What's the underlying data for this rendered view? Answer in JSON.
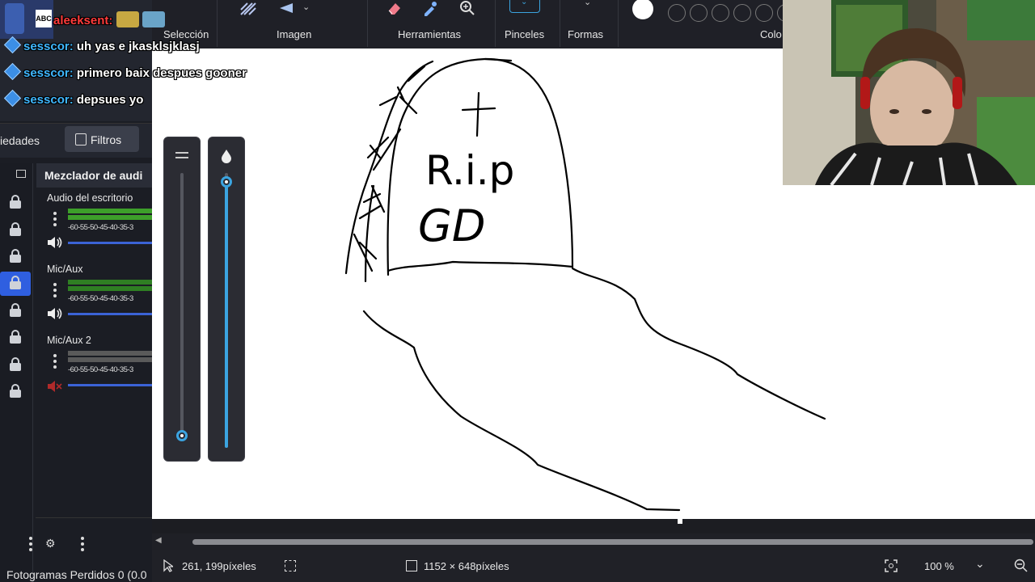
{
  "chat": {
    "messages": [
      {
        "user": "aleeksent:",
        "text": ""
      },
      {
        "user": "sesscor:",
        "text": "uh yas e jkasklsjklasj"
      },
      {
        "user": "sesscor:",
        "text": "primero baix despues gooner"
      },
      {
        "user": "sesscor:",
        "text": "depsues yo"
      }
    ]
  },
  "obs": {
    "tabs": {
      "properties": "iedades",
      "filters": "Filtros"
    },
    "mixer_title": "Mezclador de audi",
    "channels": [
      {
        "name": "Audio del escritorio",
        "scale": "-60-55-50-45-40-35-3",
        "muted": false
      },
      {
        "name": "Mic/Aux",
        "scale": "-60-55-50-45-40-35-3",
        "muted": false
      },
      {
        "name": "Mic/Aux 2",
        "scale": "-60-55-50-45-40-35-3",
        "muted": true
      }
    ],
    "status": "Fotogramas Perdidos 0 (0.0"
  },
  "ribbon": {
    "groups": [
      "Selección",
      "Imagen",
      "Herramientas",
      "Pinceles",
      "Formas",
      "Colo"
    ]
  },
  "drawing": {
    "cross": "+",
    "line1": "R.i.p",
    "line2": "GD"
  },
  "statusbar": {
    "cursor": "261, 199píxeles",
    "size": "1152 × 648píxeles",
    "zoom": "100 %"
  },
  "colors": {
    "accent": "#3ba4e0",
    "obs_selected": "#2f5fe0",
    "meter_green": "#3d9f2a"
  }
}
